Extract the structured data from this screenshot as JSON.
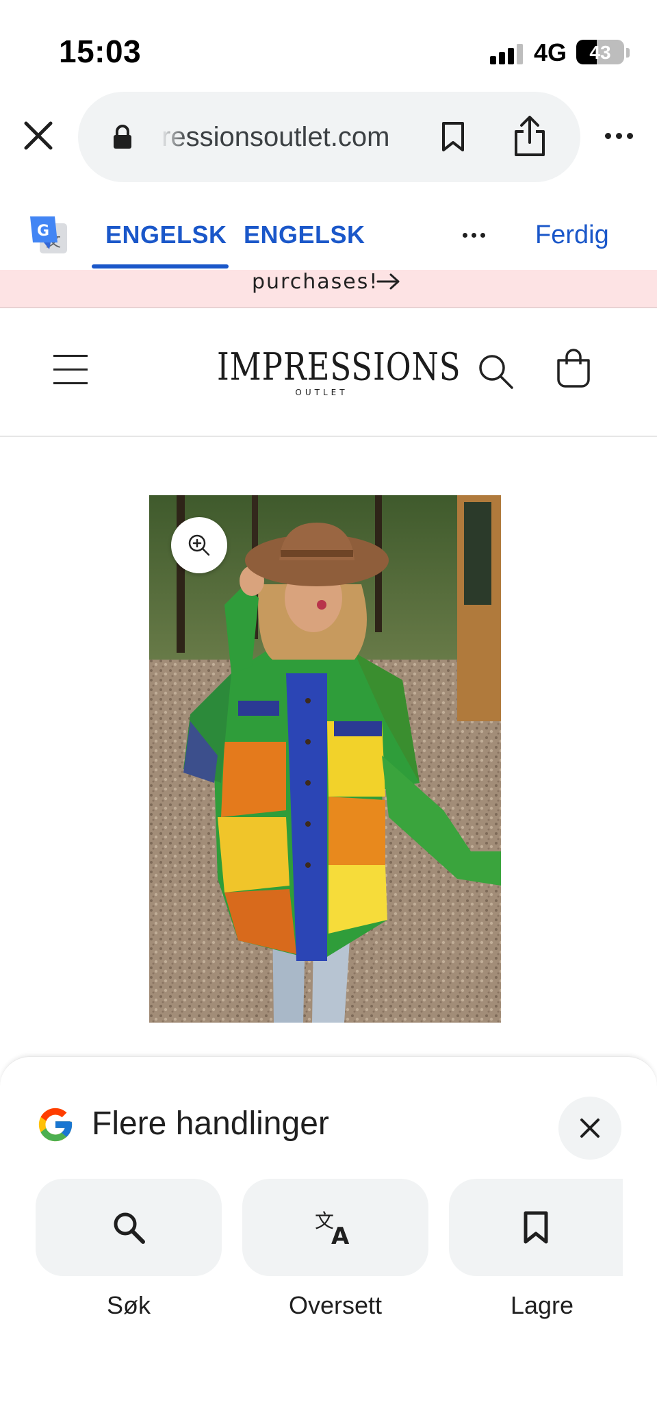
{
  "status_bar": {
    "time": "15:03",
    "network": "4G",
    "battery_level": "43",
    "battery_fraction": 0.43,
    "signal_bars_active": 3
  },
  "browser": {
    "url_text": "ressionsoutlet.com",
    "icons": {
      "close": "close-icon",
      "lock": "lock-icon",
      "bookmark": "bookmark-icon",
      "share": "share-icon",
      "more": "more-icon"
    }
  },
  "translate_bar": {
    "source_tab": "ENGELSK",
    "target_tab": "ENGELSK",
    "done_label": "Ferdig",
    "accent_color": "#1a57c9"
  },
  "promo": {
    "text": "purchases!"
  },
  "store": {
    "logo_main": "IMPRESSIONS",
    "logo_sub": "OUTLET"
  },
  "sheet": {
    "title": "Flere handlinger",
    "actions": [
      {
        "label": "Søk",
        "icon": "search-icon"
      },
      {
        "label": "Oversett",
        "icon": "translate-icon"
      },
      {
        "label": "Lagre",
        "icon": "bookmark-icon"
      }
    ]
  }
}
